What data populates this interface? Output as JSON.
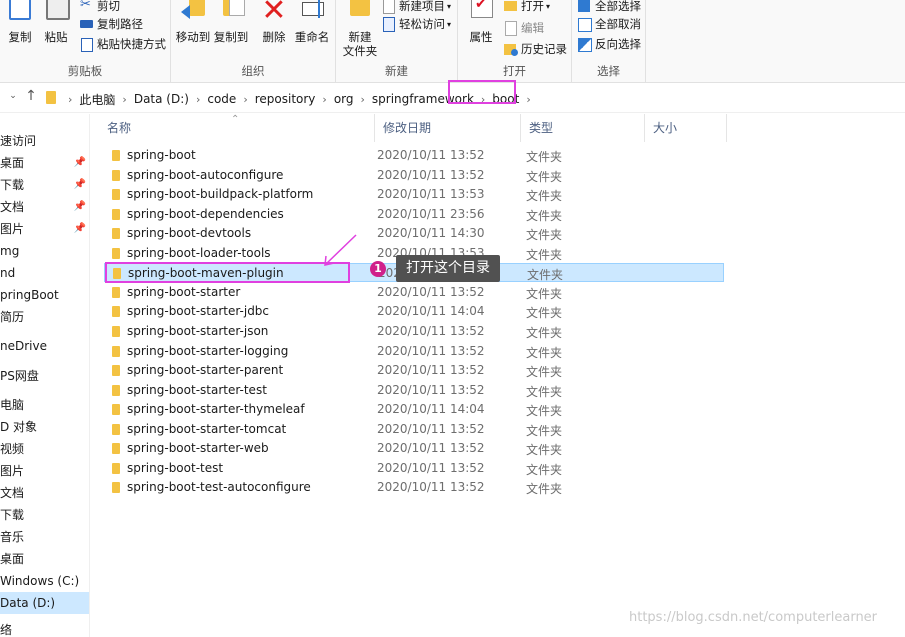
{
  "ribbon": {
    "clipboard": {
      "copy": "复制",
      "paste": "粘贴",
      "cut": "剪切",
      "copy_path": "复制路径",
      "paste_shortcut": "粘贴快捷方式",
      "label": "剪贴板"
    },
    "organize": {
      "move_to": "移动到",
      "copy_to": "复制到",
      "delete": "删除",
      "rename": "重命名",
      "label": "组织"
    },
    "new": {
      "new_folder_line1": "新建",
      "new_folder_line2": "文件夹",
      "new_item": "新建项目",
      "easy_access": "轻松访问",
      "label": "新建"
    },
    "open": {
      "properties": "属性",
      "open": "打开",
      "edit": "编辑",
      "history": "历史记录",
      "label": "打开"
    },
    "select": {
      "select_all": "全部选择",
      "select_none": "全部取消",
      "invert": "反向选择",
      "label": "选择"
    }
  },
  "address": {
    "crumbs": [
      "此电脑",
      "Data (D:)",
      "code",
      "repository",
      "org",
      "springframework",
      "boot"
    ]
  },
  "leftnav": {
    "items": [
      "速访问",
      "桌面",
      "下载",
      "文档",
      "图片",
      "mg",
      "nd",
      "pringBoot",
      "简历",
      "neDrive",
      "PS网盘",
      "电脑",
      "D 对象",
      "视频",
      "图片",
      "文档",
      "下载",
      "音乐",
      "桌面",
      "Windows (C:)",
      "Data (D:)",
      "络"
    ]
  },
  "columns": {
    "name": "名称",
    "modified": "修改日期",
    "type": "类型",
    "size": "大小"
  },
  "files": [
    {
      "name": "spring-boot",
      "date": "2020/10/11 13:52",
      "type": "文件夹"
    },
    {
      "name": "spring-boot-autoconfigure",
      "date": "2020/10/11 13:52",
      "type": "文件夹"
    },
    {
      "name": "spring-boot-buildpack-platform",
      "date": "2020/10/11 13:53",
      "type": "文件夹"
    },
    {
      "name": "spring-boot-dependencies",
      "date": "2020/10/11 23:56",
      "type": "文件夹"
    },
    {
      "name": "spring-boot-devtools",
      "date": "2020/10/11 14:30",
      "type": "文件夹"
    },
    {
      "name": "spring-boot-loader-tools",
      "date": "2020/10/11 13:53",
      "type": "文件夹"
    },
    {
      "name": "spring-boot-maven-plugin",
      "date": "2020/10/11 14:04",
      "type": "文件夹"
    },
    {
      "name": "spring-boot-starter",
      "date": "2020/10/11 13:52",
      "type": "文件夹"
    },
    {
      "name": "spring-boot-starter-jdbc",
      "date": "2020/10/11 14:04",
      "type": "文件夹"
    },
    {
      "name": "spring-boot-starter-json",
      "date": "2020/10/11 13:52",
      "type": "文件夹"
    },
    {
      "name": "spring-boot-starter-logging",
      "date": "2020/10/11 13:52",
      "type": "文件夹"
    },
    {
      "name": "spring-boot-starter-parent",
      "date": "2020/10/11 13:52",
      "type": "文件夹"
    },
    {
      "name": "spring-boot-starter-test",
      "date": "2020/10/11 13:52",
      "type": "文件夹"
    },
    {
      "name": "spring-boot-starter-thymeleaf",
      "date": "2020/10/11 14:04",
      "type": "文件夹"
    },
    {
      "name": "spring-boot-starter-tomcat",
      "date": "2020/10/11 13:52",
      "type": "文件夹"
    },
    {
      "name": "spring-boot-starter-web",
      "date": "2020/10/11 13:52",
      "type": "文件夹"
    },
    {
      "name": "spring-boot-test",
      "date": "2020/10/11 13:52",
      "type": "文件夹"
    },
    {
      "name": "spring-boot-test-autoconfigure",
      "date": "2020/10/11 13:52",
      "type": "文件夹"
    }
  ],
  "annotation": {
    "badge": "1",
    "text": "打开这个目录",
    "highlight_color": "#e040e0"
  },
  "watermark": "https://blog.csdn.net/computerlearner",
  "colors": {
    "selection": "#cce8ff",
    "folder": "#f3c242",
    "badge": "#d0208a"
  }
}
